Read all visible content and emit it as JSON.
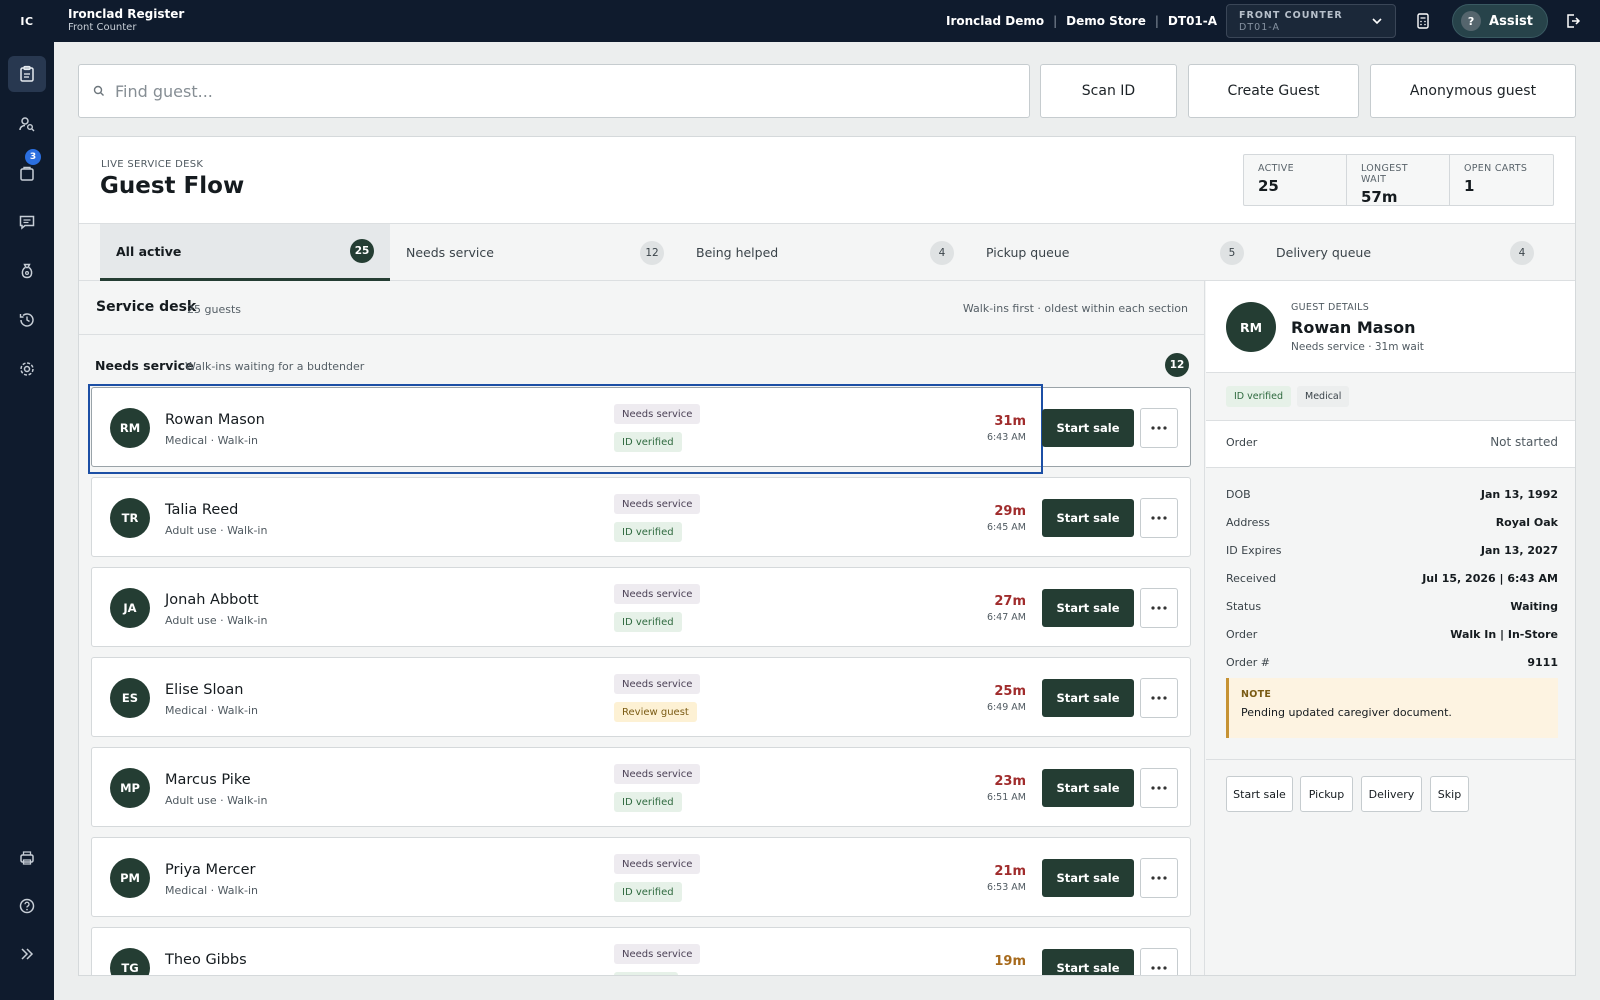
{
  "app": {
    "logo": "IC",
    "title": "Ironclad Register",
    "subtitle": "Front Counter"
  },
  "topbar": {
    "crumbs": [
      "Ironclad Demo",
      "Demo Store",
      "DT01-A"
    ],
    "counter_label": "FRONT COUNTER",
    "counter_value": "DT01-A",
    "assist_label": "Assist",
    "assist_icon_glyph": "?"
  },
  "sidebar": {
    "items": [
      {
        "name": "register",
        "icon": "clipboard-icon",
        "active": true
      },
      {
        "name": "customers",
        "icon": "user-search-icon"
      },
      {
        "name": "orders",
        "icon": "orders-icon",
        "badge": "3"
      },
      {
        "name": "messages",
        "icon": "message-icon"
      },
      {
        "name": "cash",
        "icon": "money-bag-icon"
      },
      {
        "name": "history",
        "icon": "history-icon"
      },
      {
        "name": "settings",
        "icon": "gear-icon"
      }
    ],
    "bottom": [
      "printer-icon",
      "help-icon",
      "expand-icon"
    ]
  },
  "search": {
    "placeholder": "Find guest..."
  },
  "actions": {
    "scan_id": "Scan ID",
    "create_guest": "Create Guest",
    "anonymous_guest": "Anonymous guest"
  },
  "header": {
    "eyebrow": "LIVE SERVICE DESK",
    "title": "Guest Flow",
    "stats": [
      {
        "label": "ACTIVE",
        "value": "25"
      },
      {
        "label": "LONGEST WAIT",
        "value": "57m"
      },
      {
        "label": "OPEN CARTS",
        "value": "1"
      }
    ]
  },
  "tabs": [
    {
      "label": "All active",
      "count": "25",
      "active": true
    },
    {
      "label": "Needs service",
      "count": "12"
    },
    {
      "label": "Being helped",
      "count": "4"
    },
    {
      "label": "Pickup queue",
      "count": "5"
    },
    {
      "label": "Delivery queue",
      "count": "4"
    }
  ],
  "queue": {
    "title": "Service desk",
    "count_text": "25 guests",
    "sort_text": "Walk-ins first · oldest within each section",
    "section": {
      "title": "Needs service",
      "subtitle": "Walk-ins waiting for a budtender",
      "count": "12"
    },
    "start_label": "Start sale",
    "guests": [
      {
        "initials": "RM",
        "name": "Rowan Mason",
        "sub": "Medical · Walk-in",
        "tag1": "Needs service",
        "tag2": "ID verified",
        "tag2_kind": "id",
        "wait": "31m",
        "time": "6:43 AM",
        "wait_tone": "red",
        "selected": true
      },
      {
        "initials": "TR",
        "name": "Talia Reed",
        "sub": "Adult use · Walk-in",
        "tag1": "Needs service",
        "tag2": "ID verified",
        "tag2_kind": "id",
        "wait": "29m",
        "time": "6:45 AM",
        "wait_tone": "red"
      },
      {
        "initials": "JA",
        "name": "Jonah Abbott",
        "sub": "Adult use · Walk-in",
        "tag1": "Needs service",
        "tag2": "ID verified",
        "tag2_kind": "id",
        "wait": "27m",
        "time": "6:47 AM",
        "wait_tone": "red"
      },
      {
        "initials": "ES",
        "name": "Elise Sloan",
        "sub": "Medical · Walk-in",
        "tag1": "Needs service",
        "tag2": "Review guest",
        "tag2_kind": "review",
        "wait": "25m",
        "time": "6:49 AM",
        "wait_tone": "red"
      },
      {
        "initials": "MP",
        "name": "Marcus Pike",
        "sub": "Adult use · Walk-in",
        "tag1": "Needs service",
        "tag2": "ID verified",
        "tag2_kind": "id",
        "wait": "23m",
        "time": "6:51 AM",
        "wait_tone": "red"
      },
      {
        "initials": "PM",
        "name": "Priya Mercer",
        "sub": "Medical · Walk-in",
        "tag1": "Needs service",
        "tag2": "ID verified",
        "tag2_kind": "id",
        "wait": "21m",
        "time": "6:53 AM",
        "wait_tone": "red"
      },
      {
        "initials": "TG",
        "name": "Theo Gibbs",
        "sub": "",
        "tag1": "Needs service",
        "tag2": "",
        "tag2_kind": "id",
        "wait": "19m",
        "time": "",
        "wait_tone": "amber"
      }
    ]
  },
  "details": {
    "eyebrow": "GUEST DETAILS",
    "initials": "RM",
    "name": "Rowan Mason",
    "status": "Needs service · 31m wait",
    "tags": [
      "ID verified",
      "Medical"
    ],
    "order_label": "Order",
    "order_value": "Not started",
    "fields": [
      {
        "label": "DOB",
        "value": "Jan 13, 1992"
      },
      {
        "label": "Address",
        "value": "Royal Oak"
      },
      {
        "label": "ID Expires",
        "value": "Jan 13, 2027"
      },
      {
        "label": "Received",
        "value": "Jul 15, 2026 | 6:43 AM"
      },
      {
        "label": "Status",
        "value": "Waiting"
      },
      {
        "label": "Order",
        "value": "Walk In | In-Store"
      },
      {
        "label": "Order #",
        "value": "9111"
      }
    ],
    "note_label": "NOTE",
    "note_text": "Pending updated caregiver document.",
    "actions": [
      "Start sale",
      "Pickup",
      "Delivery",
      "Skip"
    ]
  },
  "colors": {
    "sidebar_bg": "#0f1b2d",
    "accent_green": "#243d33",
    "wait_red": "#a02c2c",
    "wait_amber": "#a76a1c",
    "focus_blue": "#1c4fa5"
  }
}
